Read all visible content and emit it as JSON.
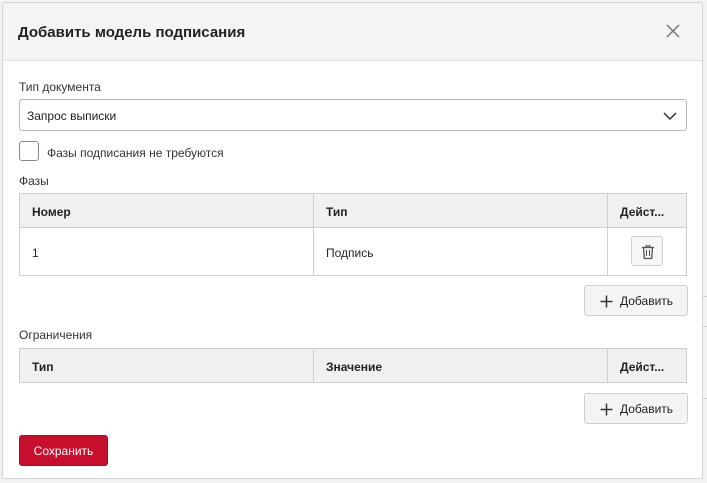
{
  "dialog": {
    "title": "Добавить модель подписания"
  },
  "document_type": {
    "label": "Тип документа",
    "value": "Запрос выписки"
  },
  "no_phases_checkbox": {
    "label": "Фазы подписания не требуются",
    "checked": false
  },
  "phases": {
    "label": "Фазы",
    "columns": [
      "Номер",
      "Тип",
      "Дейст..."
    ],
    "rows": [
      {
        "number": "1",
        "type": "Подпись"
      }
    ],
    "add_label": "Добавить"
  },
  "restrictions": {
    "label": "Ограничения",
    "columns": [
      "Тип",
      "Значение",
      "Дейст..."
    ],
    "rows": [],
    "add_label": "Добавить"
  },
  "footer": {
    "save_label": "Сохранить"
  },
  "colors": {
    "save_button": "#c8102e",
    "header_bg": "#f4f4f4"
  }
}
